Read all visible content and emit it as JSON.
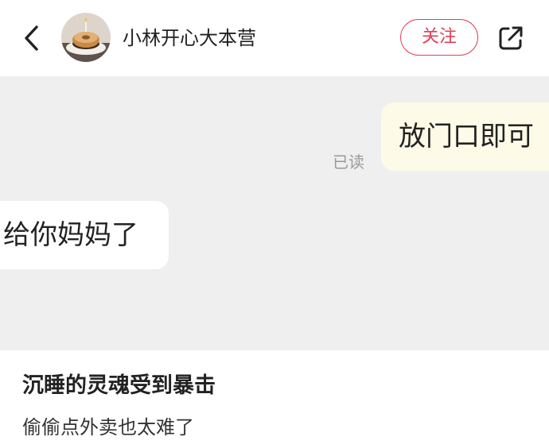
{
  "header": {
    "back_icon": "chevron-left-icon",
    "username": "小林开心大本营",
    "follow_label": "关注",
    "share_icon": "share-external-icon",
    "accent_color": "#e23e57"
  },
  "chat": {
    "outgoing_message": "放门口即可",
    "read_status": "已读",
    "incoming_message": "给你妈妈了",
    "outgoing_bubble_color": "#fdfbe7",
    "background_color": "#efefef"
  },
  "post": {
    "title": "沉睡的灵魂受到暴击",
    "body": "偷偷点外卖也太难了"
  }
}
